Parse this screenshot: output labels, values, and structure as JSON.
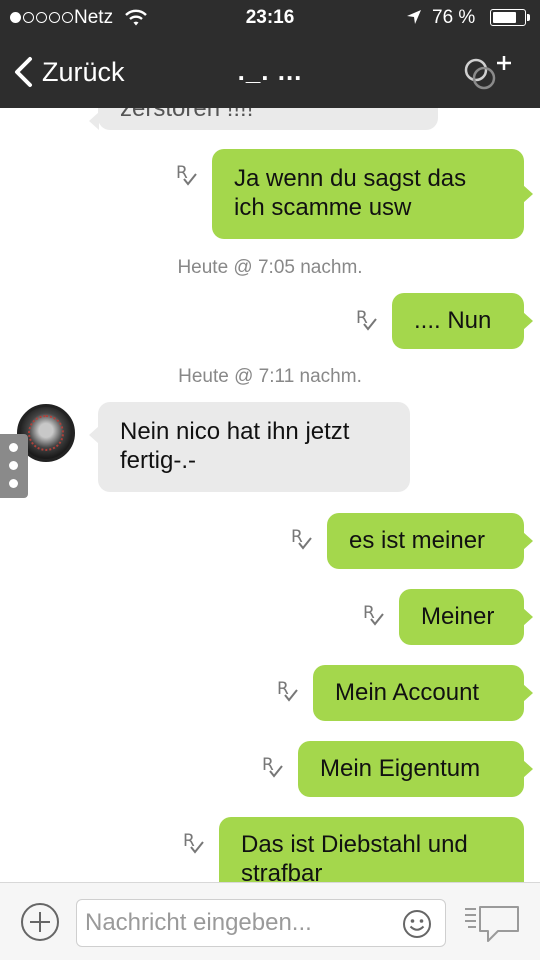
{
  "status_bar": {
    "carrier": "Netz",
    "time": "23:16",
    "battery_percent": "76 %",
    "battery_level": 0.76
  },
  "nav": {
    "back_label": "Zurück",
    "title": "._. ..."
  },
  "messages": {
    "cut_top_text": "zerstören !!!!",
    "m1": "Ja wenn du sagst das ich scamme usw",
    "ts1": "Heute @ 7:05 nachm.",
    "m2": ".... Nun",
    "ts2": "Heute @ 7:11 nachm.",
    "m3": "Nein nico hat ihn jetzt fertig-.-",
    "m4": "es ist meiner",
    "m5": "Meiner",
    "m6": "Mein Account",
    "m7": "Mein Eigentum",
    "m8": "Das ist Diebstahl und strafbar"
  },
  "receipt_letter": "R",
  "input": {
    "placeholder": "Nachricht eingeben..."
  },
  "colors": {
    "header": "#2d2d2d",
    "outgoing_bubble": "#a4d74c",
    "incoming_bubble": "#eaeaea"
  },
  "icons": [
    "back-chevron-icon",
    "add-contact-icon",
    "read-receipt-icon",
    "plus-icon",
    "smiley-icon",
    "send-icon",
    "wifi-icon",
    "location-arrow-icon",
    "battery-icon"
  ]
}
